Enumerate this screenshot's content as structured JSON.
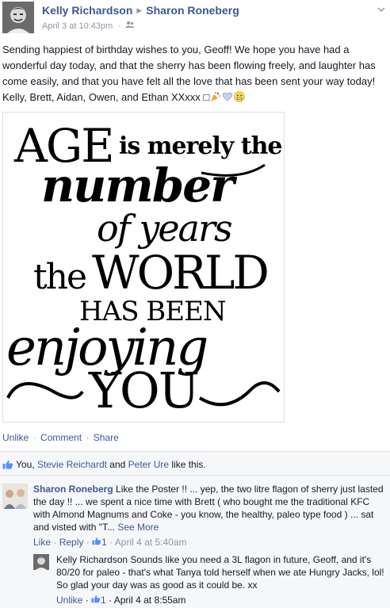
{
  "post": {
    "author": "Kelly Richardson",
    "recipient": "Sharon Roneberg",
    "separator_icon": "triangle-right-icon",
    "timestamp": "April 3 at 10:43pm",
    "audience_icon": "friends-icon",
    "message": "Sending happiest of birthday wishes to you, Geoff! We hope you have had a wonderful day today, and that the sherry has been flowing freely, and laughter has come easily, and that you have felt all the love that has been sent your way today! Kelly, Brett, Aidan, Owen, and Ethan XXxxx □",
    "emojis": [
      "party-popper-icon",
      "heart-icon",
      "smiley-icon"
    ],
    "poster_lines": [
      "AGE",
      "is merely the",
      "number",
      "of years",
      "the",
      "WORLD",
      "HAS BEEN",
      "enjoying",
      "YOU"
    ]
  },
  "actions": {
    "unlike": "Unlike",
    "comment": "Comment",
    "share": "Share",
    "dot": "·"
  },
  "likes": {
    "you": "You, ",
    "person1": "Stevie Reichardt",
    "and": " and ",
    "person2": "Peter Ure",
    "suffix": " like this."
  },
  "comments": [
    {
      "author": "Sharon Roneberg",
      "text": " Like the Poster !! ... yep, the two litre flagon of sherry just lasted the day !! ... we spent a nice time with Brett ( who bought me the traditional KFC with Almond Magnums and Coke - you know, the healthy, paleo type food ) ... sat and visted with \"T... ",
      "see_more": "See More",
      "like": "Like",
      "reply": "Reply",
      "like_count": "1",
      "time": "April 4 at 5:40am"
    }
  ],
  "reply": {
    "author": "Kelly Richardson",
    "text": " Sounds like you need a 3L flagon in future, Geoff, and it's 80/20 for paleo - that's what Tanya told herself when we ate Hungry Jacks, lol! So glad your day was as good as it could be. xx",
    "unlike": "Unlike",
    "like_count": "1",
    "time": "April 4 at 8:55am"
  },
  "colors": {
    "link": "#3b5998",
    "meta": "#9197a3",
    "ufi_bg": "#f6f7f9"
  }
}
